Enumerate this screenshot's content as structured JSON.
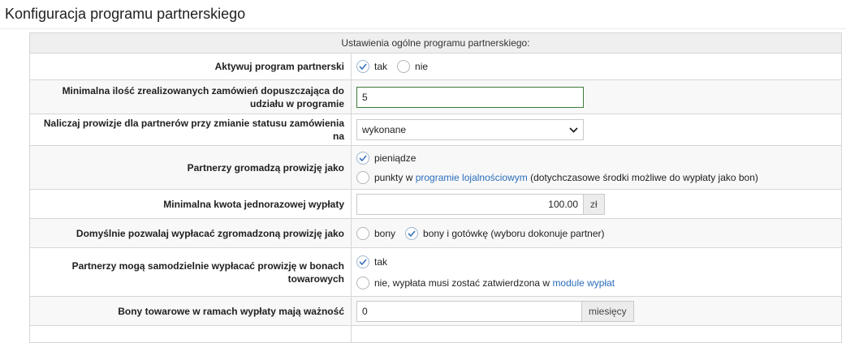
{
  "page": {
    "title": "Konfiguracja programu partnerskiego"
  },
  "table": {
    "header": "Ustawienia ogólne programu partnerskiego:"
  },
  "rows": {
    "activate": {
      "label": "Aktywuj program partnerski",
      "opt_yes": "tak",
      "opt_no": "nie",
      "selected": "tak"
    },
    "min_orders": {
      "label": "Minimalna ilość zrealizowanych zamówień dopuszczająca do udziału w programie",
      "value": "5"
    },
    "commission_status": {
      "label": "Naliczaj prowizje dla partnerów przy zmianie statusu zamówienia na",
      "value": "wykonane"
    },
    "collect": {
      "label": "Partnerzy gromadzą prowizję jako",
      "opt_money": "pieniądze",
      "opt_points_prefix": "punkty w",
      "opt_points_link": "programie lojalnościowym",
      "opt_points_suffix": "(dotychczasowe środki możliwe do wypłaty jako bon)",
      "selected": "pieniądze"
    },
    "min_payout": {
      "label": "Minimalna kwota jednorazowej wypłaty",
      "value": "100.00",
      "unit": "zł"
    },
    "default_payout": {
      "label": "Domyślnie pozwalaj wypłacać zgromadzoną prowizję jako",
      "opt_vouchers": "bony",
      "opt_both": "bony i gotówkę (wyboru dokonuje partner)",
      "selected": "bony i gotówkę (wyboru dokonuje partner)"
    },
    "self_payout": {
      "label": "Partnerzy mogą samodzielnie wypłacać prowizję w bonach towarowych",
      "opt_yes": "tak",
      "opt_no_prefix": "nie, wypłata musi zostać zatwierdzona w",
      "opt_no_link": "module wypłat",
      "selected": "tak"
    },
    "voucher_validity": {
      "label": "Bony towarowe w ramach wypłaty mają ważność",
      "value": "0",
      "unit": "miesięcy"
    }
  },
  "colors": {
    "accent": "#2a6dbb",
    "focus_border": "#3c7a3c"
  }
}
